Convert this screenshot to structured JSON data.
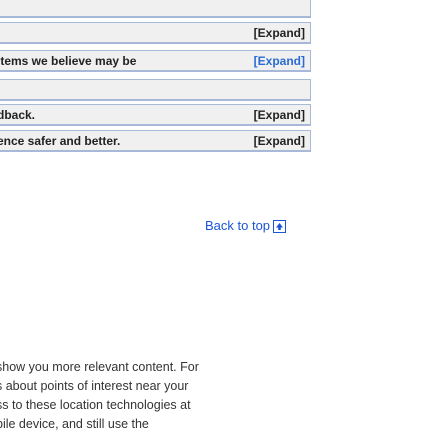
{
  "rows": [
    {
      "text": "",
      "expand_link": ""
    },
    {
      "text": "",
      "expand_link": "[Expand]"
    },
    {
      "text": "items we believe may be ",
      "expand_link": "[Expand]"
    },
    {
      "text": "",
      "expand_link": ""
    },
    {
      "text": "dback.",
      "expand_link": "[Expand]"
    },
    {
      "text": "ence safer and better.",
      "expand_link": "[Expand]"
    }
  ],
  "back_to_top": {
    "label": "Back to top",
    "icon": "arrow-up-square-icon"
  },
  "paragraph": {
    "lines": [
      "show you more relevant content. For",
      "s about points of interest near your",
      "ss to these location technologies at",
      "bile device, and still use the"
    ]
  },
  "colors": {
    "row_bg": "#f0f0f0",
    "row_border": "#a8b8d8",
    "link": "#1a55d6"
  }
}
